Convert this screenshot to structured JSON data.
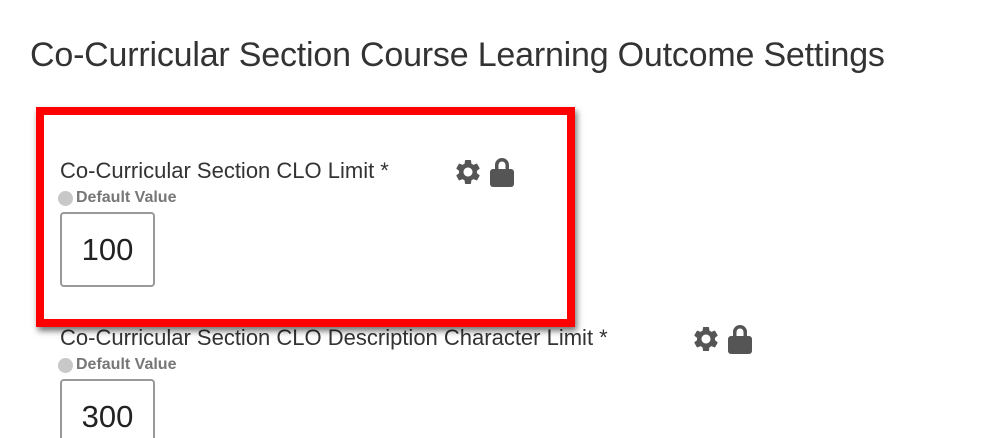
{
  "page": {
    "title": "Co-Curricular Section Course Learning Outcome Settings"
  },
  "settings": [
    {
      "label": "Co-Curricular Section CLO Limit *",
      "default_label": "Default Value",
      "value": "100",
      "icons": [
        "gear-icon",
        "lock-icon"
      ]
    },
    {
      "label": "Co-Curricular Section CLO Description Character Limit *",
      "default_label": "Default Value",
      "value": "300",
      "icons": [
        "gear-icon",
        "lock-icon"
      ]
    }
  ],
  "colors": {
    "highlight": "#ff0000",
    "icon": "#555555",
    "text": "#333333"
  }
}
